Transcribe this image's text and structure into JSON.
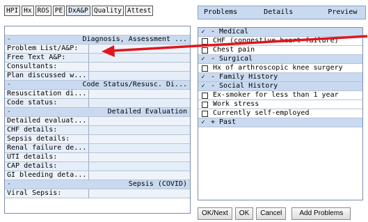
{
  "left_tabs": [
    "HPI",
    "Hx",
    "ROS",
    "PE",
    "DxA&P",
    "Quality",
    "Attest"
  ],
  "form": {
    "sections": [
      {
        "title": "Diagnosis, Assessment ...",
        "fields": [
          "Problem List/A&P:",
          "Free Text A&P:",
          "Consultants:",
          "Plan discussed w..."
        ]
      },
      {
        "title": "Code Status/Resusc. Di...",
        "fields": [
          "Resuscitation di...",
          "Code status:"
        ]
      },
      {
        "title": "Detailed Evaluation",
        "fields": [
          "Detailed evaluat...",
          "CHF details:",
          "Sepsis details:",
          "Renal failure de...",
          "UTI details:",
          "CAP details:",
          "GI bleeding deta..."
        ]
      },
      {
        "title": "Sepsis (COVID)",
        "fields": [
          "Viral Sepsis:"
        ]
      }
    ],
    "section_dash": "-"
  },
  "right_tabs": {
    "problems": "Problems",
    "details": "Details",
    "preview": "Preview"
  },
  "problems": [
    {
      "type": "group",
      "mark": "✓",
      "text": "- Medical"
    },
    {
      "type": "item",
      "text": "CHF (congestive heart failure)"
    },
    {
      "type": "item",
      "text": "Chest pain"
    },
    {
      "type": "group",
      "mark": "✓",
      "text": "- Surgical"
    },
    {
      "type": "item",
      "text": "Hx of arthroscopic knee surgery"
    },
    {
      "type": "group",
      "mark": "✓",
      "text": "- Family History"
    },
    {
      "type": "group",
      "mark": "✓",
      "text": "- Social History"
    },
    {
      "type": "item",
      "text": "Ex-smoker for less than 1 year"
    },
    {
      "type": "item",
      "text": "Work stress"
    },
    {
      "type": "item",
      "text": "Currently self-employed"
    },
    {
      "type": "group",
      "mark": "✓",
      "text": "+ Past"
    }
  ],
  "buttons": {
    "ok_next": "OK/Next",
    "ok": "OK",
    "cancel": "Cancel",
    "add_problems": "Add Problems"
  },
  "colors": {
    "arrow": "#e0151b",
    "section_bg": "#c9daf0"
  }
}
